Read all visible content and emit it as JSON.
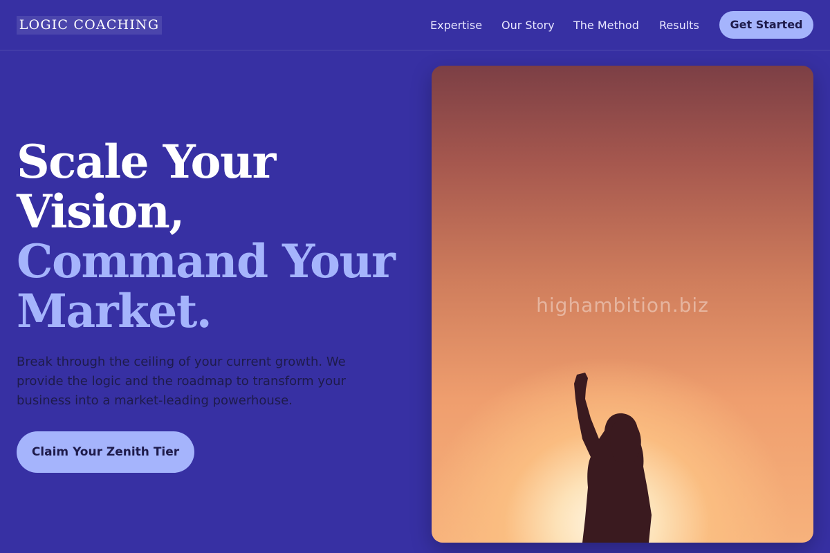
{
  "header": {
    "logo": "LOGIC COACHING",
    "nav": [
      "Expertise",
      "Our Story",
      "The Method",
      "Results"
    ],
    "cta": "Get Started"
  },
  "hero": {
    "title_lines": [
      "Scale Your",
      "Vision,"
    ],
    "title_accent_lines": [
      "Command Your",
      "Market."
    ],
    "description": "Break through the ceiling of your current growth. We provide the logic and the roadmap to transform your business into a market-leading powerhouse.",
    "cta": "Claim Your Zenith Tier",
    "image": {
      "watermark": "highambition.biz",
      "subject": "person-silhouette-raised-fist-sunset"
    }
  },
  "colors": {
    "background": "#3730a3",
    "accent": "#a5b4fc",
    "dark_text": "#1e1b4b"
  }
}
